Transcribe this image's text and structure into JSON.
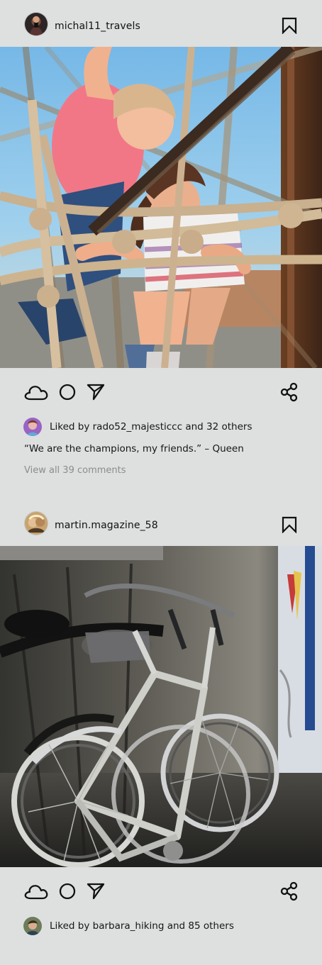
{
  "colors": {
    "background": "#dde0df",
    "text": "#161616",
    "muted_text": "#8a8d8d",
    "icon": "#111111"
  },
  "posts": [
    {
      "username": "michal11_travels",
      "image_description_icon": "children-rope-climbing-photo",
      "likes_text": "Liked by rado52_majesticcc and 32 others",
      "caption": "“We are the champions, my friends.” – Queen",
      "comments_link": "View all 39 comments",
      "icons": {
        "like": "cloud-icon",
        "comment": "circle-icon",
        "send": "send-icon",
        "share": "share-icon",
        "save": "bookmark-icon"
      }
    },
    {
      "username": "martin.magazine_58",
      "image_description_icon": "parked-bicycles-photo",
      "likes_text": "Liked by barbara_hiking and 85 others",
      "icons": {
        "like": "cloud-icon",
        "comment": "circle-icon",
        "send": "send-icon",
        "share": "share-icon",
        "save": "bookmark-icon"
      }
    }
  ]
}
